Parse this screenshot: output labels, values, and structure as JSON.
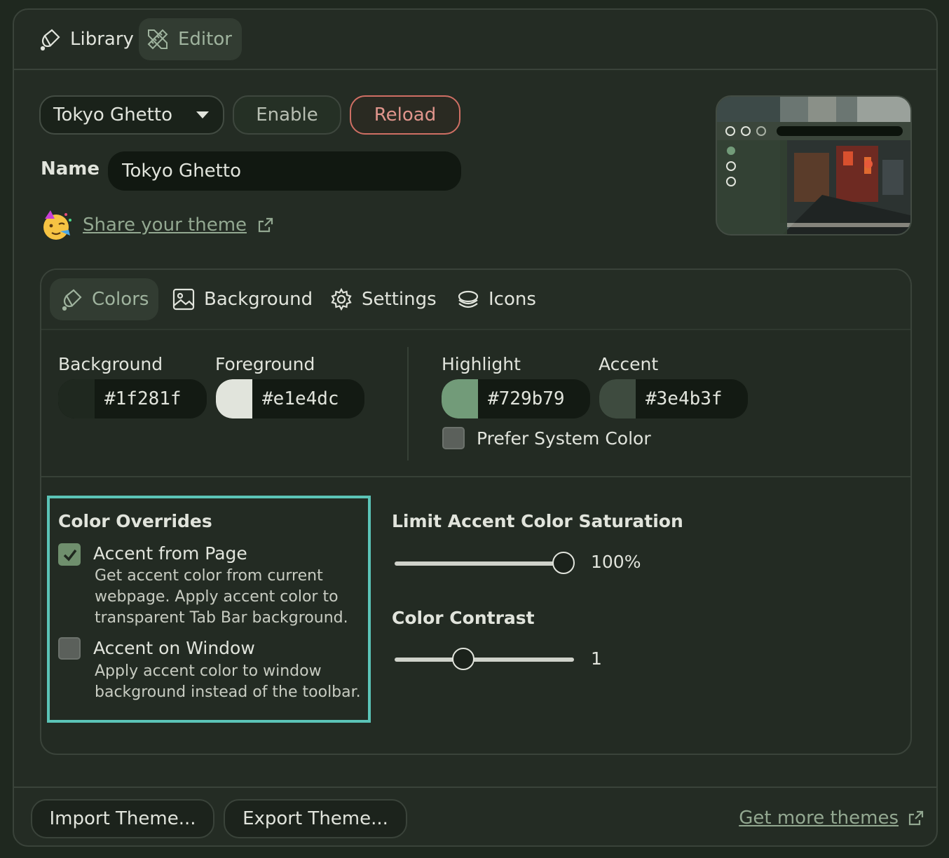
{
  "top_tabs": [
    {
      "label": "Library",
      "icon": "paint-bucket-icon",
      "active": false
    },
    {
      "label": "Editor",
      "icon": "pencil-ruler-icon",
      "active": true
    }
  ],
  "theme_select": {
    "value": "Tokyo Ghetto"
  },
  "buttons": {
    "enable": "Enable",
    "reload": "Reload"
  },
  "name": {
    "label": "Name",
    "value": "Tokyo Ghetto"
  },
  "share": {
    "emoji": "partying-face",
    "link": "Share your theme"
  },
  "panel_tabs": [
    {
      "label": "Colors",
      "icon": "paint-bucket-icon",
      "active": true
    },
    {
      "label": "Background",
      "icon": "image-icon",
      "active": false
    },
    {
      "label": "Settings",
      "icon": "gear-icon",
      "active": false
    },
    {
      "label": "Icons",
      "icon": "layers-icon",
      "active": false
    }
  ],
  "colors": {
    "background": {
      "label": "Background",
      "hex": "#1f281f"
    },
    "foreground": {
      "label": "Foreground",
      "hex": "#e1e4dc"
    },
    "highlight": {
      "label": "Highlight",
      "hex": "#729b79"
    },
    "accent": {
      "label": "Accent",
      "hex": "#3e4b3f"
    },
    "prefer_system": {
      "label": "Prefer System Color",
      "checked": false
    }
  },
  "overrides": {
    "title": "Color Overrides",
    "accent_from_page": {
      "label": "Accent from Page",
      "checked": true,
      "description": "Get accent color from current webpage. Apply accent color to transparent Tab Bar background."
    },
    "accent_on_window": {
      "label": "Accent on Window",
      "checked": false,
      "description": "Apply accent color to window background instead of the toolbar."
    }
  },
  "saturation": {
    "title": "Limit Accent Color Saturation",
    "value_label": "100%",
    "value": 1.0
  },
  "contrast": {
    "title": "Color Contrast",
    "value_label": "1",
    "value": 0.4
  },
  "footer": {
    "import": "Import Theme...",
    "export": "Export Theme...",
    "more": "Get more themes"
  },
  "accent_colors": {
    "tab_active_text": "#9fb39e",
    "reload": "#e0958c",
    "highlight_box": "#5bc4b7"
  }
}
